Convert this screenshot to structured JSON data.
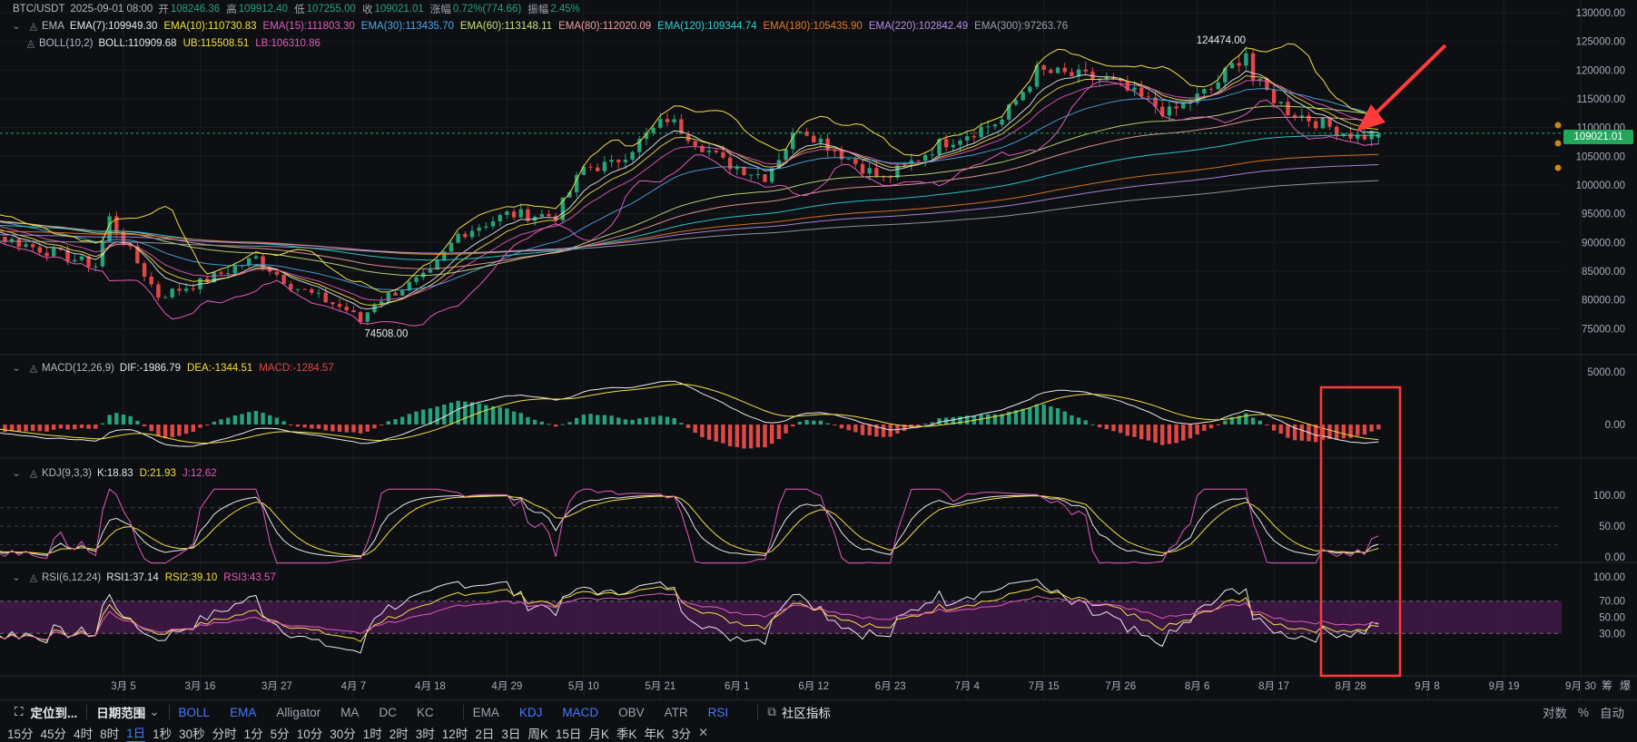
{
  "colors": {
    "up": "#25a37a",
    "down": "#e04848",
    "bg": "#0e0f13",
    "grid": "#1c1e24",
    "accent": "#3f7cff",
    "price_tag": "#22a65a",
    "annotation": "#ff3b3b"
  },
  "header": {
    "symbol": "BTC/USDT",
    "date": "2025-09-01 08:00",
    "open_label": "开",
    "open": "108246.36",
    "high_label": "高",
    "high": "109912.40",
    "low_label": "低",
    "low": "107255.00",
    "close_label": "收",
    "close": "109021.01",
    "change_label": "涨幅",
    "change": "0.72%(774.66)",
    "amp_label": "振幅",
    "amp": "2.45%"
  },
  "ema_legend": {
    "name": "EMA",
    "items": [
      {
        "text": "EMA(7):109949.30",
        "color": "#e6e8ec"
      },
      {
        "text": "EMA(10):110730.83",
        "color": "#f0e040"
      },
      {
        "text": "EMA(15):111803.30",
        "color": "#e25ab8"
      },
      {
        "text": "EMA(30):113435.70",
        "color": "#4aa8e8"
      },
      {
        "text": "EMA(60):113148.11",
        "color": "#c8e07a"
      },
      {
        "text": "EMA(80):112020.09",
        "color": "#f0a0a0"
      },
      {
        "text": "EMA(120):109344.74",
        "color": "#2ad4d4"
      },
      {
        "text": "EMA(180):105435.90",
        "color": "#e87a20"
      },
      {
        "text": "EMA(220):102842.49",
        "color": "#b48ee8"
      },
      {
        "text": "EMA(300):97263.76",
        "color": "#9aa0aa"
      }
    ]
  },
  "boll_legend": {
    "name": "BOLL(10,2)",
    "items": [
      {
        "text": "BOLL:110909.68",
        "color": "#e6e8ec"
      },
      {
        "text": "UB:115508.51",
        "color": "#f0e040"
      },
      {
        "text": "LB:106310.86",
        "color": "#e25ab8"
      }
    ]
  },
  "macd_legend": {
    "name": "MACD(12,26,9)",
    "items": [
      {
        "text": "DIF:-1986.79",
        "color": "#e6e8ec"
      },
      {
        "text": "DEA:-1344.51",
        "color": "#f0e040"
      },
      {
        "text": "MACD:-1284.57",
        "color": "#e04848"
      }
    ]
  },
  "kdj_legend": {
    "name": "KDJ(9,3,3)",
    "items": [
      {
        "text": "K:18.83",
        "color": "#e6e8ec"
      },
      {
        "text": "D:21.93",
        "color": "#f0e040"
      },
      {
        "text": "J:12.62",
        "color": "#e25ab8"
      }
    ]
  },
  "rsi_legend": {
    "name": "RSI(6,12,24)",
    "items": [
      {
        "text": "RSI1:37.14",
        "color": "#e6e8ec"
      },
      {
        "text": "RSI2:39.10",
        "color": "#f0e040"
      },
      {
        "text": "RSI3:43.57",
        "color": "#e25ab8"
      }
    ]
  },
  "price_axis": [
    "130000.00",
    "125000.00",
    "120000.00",
    "115000.00",
    "110000.00",
    "105000.00",
    "100000.00",
    "95000.00",
    "90000.00",
    "85000.00",
    "80000.00",
    "75000.00"
  ],
  "macd_axis": [
    "5000.00",
    "0.00"
  ],
  "kdj_axis": [
    "100.00",
    "50.00",
    "0.00"
  ],
  "rsi_axis": [
    "100.00",
    "70.00",
    "50.00",
    "30.00"
  ],
  "current_price": "109021.01",
  "high_marker": "124474.00",
  "low_marker": "74508.00",
  "x_axis": [
    "3月 5",
    "3月 16",
    "3月 27",
    "4月 7",
    "4月 18",
    "4月 29",
    "5月 10",
    "5月 21",
    "6月 1",
    "6月 12",
    "6月 23",
    "7月 4",
    "7月 15",
    "7月 26",
    "8月 6",
    "8月 17",
    "8月 28",
    "9月 8",
    "9月 19",
    "9月 30"
  ],
  "x_right": [
    "筹",
    "爆"
  ],
  "toolbar": {
    "locate": "定位到...",
    "range": "日期范围",
    "main_indicators": [
      "BOLL",
      "EMA",
      "Alligator",
      "MA",
      "DC",
      "KC"
    ],
    "main_active": [
      true,
      true,
      false,
      false,
      false,
      false
    ],
    "sub_indicators": [
      "EMA",
      "KDJ",
      "MACD",
      "OBV",
      "ATR",
      "RSI"
    ],
    "sub_active": [
      false,
      true,
      true,
      false,
      false,
      true
    ],
    "community": "社区指标",
    "log": "对数",
    "pct": "%",
    "auto": "自动"
  },
  "intervals": [
    "15分",
    "45分",
    "4时",
    "8时",
    "1日",
    "1秒",
    "30秒",
    "分时",
    "1分",
    "5分",
    "10分",
    "30分",
    "1时",
    "2时",
    "3时",
    "12时",
    "2日",
    "3日",
    "周K",
    "15日",
    "月K",
    "季K",
    "年K",
    "3分"
  ],
  "active_interval": "1日",
  "close_icon": "close-icon",
  "chart_data": {
    "type": "candlestick",
    "title": "BTC/USDT",
    "price_range": [
      72000,
      130000
    ],
    "x_range_dates": [
      "3月 5",
      "9月 30"
    ],
    "anchors": [
      {
        "x": "3月 1",
        "close": 86000
      },
      {
        "x": "3月 3",
        "close": 94200
      },
      {
        "x": "3月 10",
        "close": 80700
      },
      {
        "x": "3月 16",
        "close": 83000
      },
      {
        "x": "3月 24",
        "close": 87300
      },
      {
        "x": "3月 29",
        "close": 82600
      },
      {
        "x": "4月 6",
        "close": 78300
      },
      {
        "x": "4月 8",
        "close": 76300
      },
      {
        "x": "4月 10",
        "close": 79600
      },
      {
        "x": "4月 18",
        "close": 84500
      },
      {
        "x": "4月 22",
        "close": 91400
      },
      {
        "x": "4月 29",
        "close": 94900
      },
      {
        "x": "5月 6",
        "close": 94700
      },
      {
        "x": "5月 10",
        "close": 103000
      },
      {
        "x": "5月 14",
        "close": 103500
      },
      {
        "x": "5月 22",
        "close": 111600
      },
      {
        "x": "5月 30",
        "close": 104000
      },
      {
        "x": "6月 5",
        "close": 101500
      },
      {
        "x": "6月 10",
        "close": 110200
      },
      {
        "x": "6月 17",
        "close": 104600
      },
      {
        "x": "6月 22",
        "close": 100900
      },
      {
        "x": "6月 30",
        "close": 107100
      },
      {
        "x": "7月 9",
        "close": 111300
      },
      {
        "x": "7月 14",
        "close": 119800
      },
      {
        "x": "7月 24",
        "close": 118300
      },
      {
        "x": "8月 2",
        "close": 112500
      },
      {
        "x": "8月 8",
        "close": 116700
      },
      {
        "x": "8月 13",
        "close": 123300
      },
      {
        "x": "8月 14",
        "close": 118300
      },
      {
        "x": "8月 19",
        "close": 113000
      },
      {
        "x": "8月 25",
        "close": 110100
      },
      {
        "x": "8月 29",
        "close": 108400
      },
      {
        "x": "9月 1",
        "close": 109021
      }
    ],
    "high_point": {
      "x": "8月 14",
      "value": 124474.0
    },
    "low_point": {
      "x": "4月 7",
      "value": 74508.0
    },
    "last": {
      "open": 108246.36,
      "high": 109912.4,
      "low": 107255.0,
      "close": 109021.01
    },
    "ema_last": {
      "EMA7": 109949.3,
      "EMA10": 110730.83,
      "EMA15": 111803.3,
      "EMA30": 113435.7,
      "EMA60": 113148.11,
      "EMA80": 112020.09,
      "EMA120": 109344.74,
      "EMA180": 105435.9,
      "EMA220": 102842.49,
      "EMA300": 97263.76
    },
    "boll_last": {
      "mid": 110909.68,
      "upper": 115508.51,
      "lower": 106310.86
    },
    "macd_last": {
      "dif": -1986.79,
      "dea": -1344.51,
      "hist": -1284.57
    },
    "kdj_last": {
      "k": 18.83,
      "d": 21.93,
      "j": 12.62
    },
    "rsi_last": {
      "rsi6": 37.14,
      "rsi12": 39.1,
      "rsi24": 43.57
    },
    "rsi_band": [
      30,
      70
    ]
  }
}
